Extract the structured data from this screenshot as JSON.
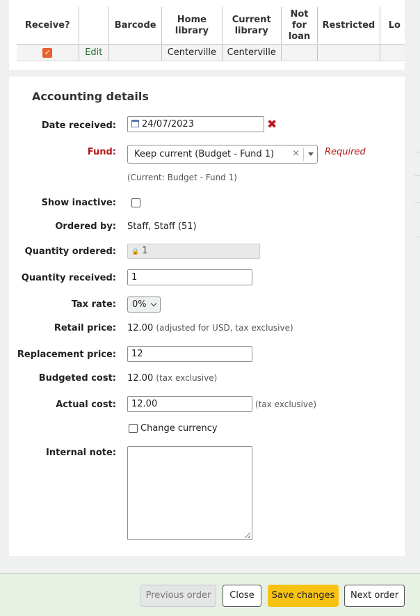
{
  "items_table": {
    "headers": [
      "Receive?",
      "",
      "Barcode",
      "Home library",
      "Current library",
      "Not for loan",
      "Restricted",
      "Lo"
    ],
    "row": {
      "receive_checked": true,
      "edit_label": "Edit",
      "barcode": "",
      "home_library": "Centerville",
      "current_library": "Centerville",
      "not_for_loan": "",
      "restricted": ""
    }
  },
  "accounting": {
    "title": "Accounting details",
    "date_received": {
      "label": "Date received:",
      "value": "24/07/2023"
    },
    "fund": {
      "label": "Fund:",
      "selected": "Keep current (Budget - Fund 1)",
      "clear": "×",
      "required": "Required",
      "current": "(Current: Budget - Fund 1)"
    },
    "show_inactive": {
      "label": "Show inactive:",
      "checked": false
    },
    "ordered_by": {
      "label": "Ordered by:",
      "value": "Staff, Staff (51)"
    },
    "quantity_ordered": {
      "label": "Quantity ordered:",
      "value": "1",
      "lock": "🔒"
    },
    "quantity_received": {
      "label": "Quantity received:",
      "value": "1"
    },
    "tax_rate": {
      "label": "Tax rate:",
      "value": "0%"
    },
    "retail_price": {
      "label": "Retail price:",
      "value": "12.00",
      "note": "(adjusted for USD, tax exclusive)"
    },
    "replacement_price": {
      "label": "Replacement price:",
      "value": "12"
    },
    "budgeted_cost": {
      "label": "Budgeted cost:",
      "value": "12.00",
      "note": "(tax exclusive)"
    },
    "actual_cost": {
      "label": "Actual cost:",
      "value": "12.00",
      "note": "(tax exclusive)"
    },
    "change_currency": {
      "label": "Change currency",
      "checked": false
    },
    "internal_note": {
      "label": "Internal note:",
      "value": ""
    }
  },
  "footer": {
    "previous": "Previous order",
    "close": "Close",
    "save": "Save changes",
    "next": "Next order"
  },
  "colors": {
    "save_button": "#f7c211",
    "required": "#b01b1b",
    "receive_checkbox": "#e8612c"
  }
}
